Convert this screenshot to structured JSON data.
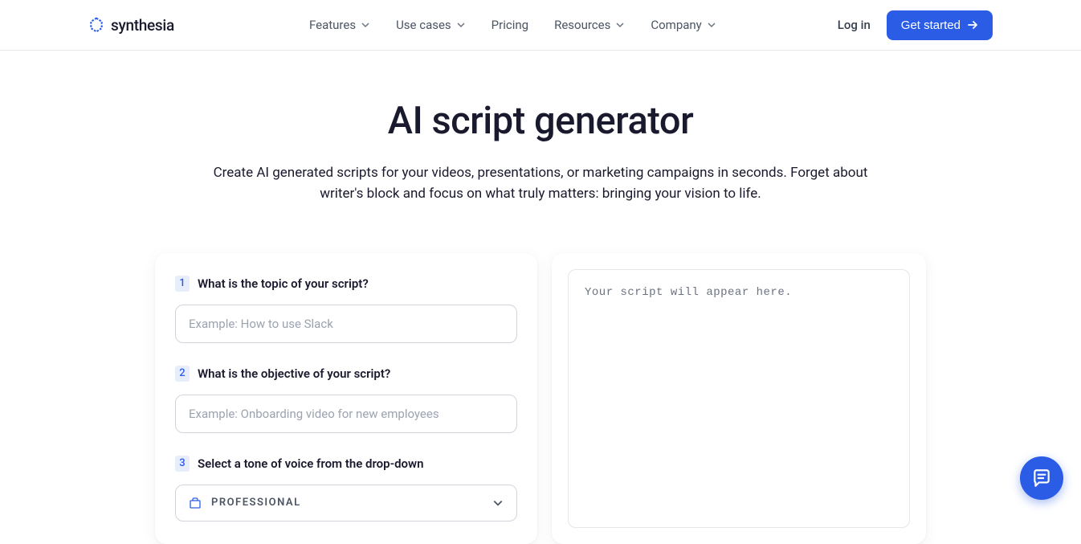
{
  "header": {
    "logo_text": "synthesia",
    "nav": {
      "features": "Features",
      "use_cases": "Use cases",
      "pricing": "Pricing",
      "resources": "Resources",
      "company": "Company"
    },
    "login": "Log in",
    "get_started": "Get started"
  },
  "hero": {
    "title": "AI script generator",
    "subtitle": "Create AI generated scripts for your videos, presentations, or marketing campaigns in seconds. Forget about writer's block and focus on what truly matters: bringing your vision to life."
  },
  "form": {
    "step1": {
      "number": "1",
      "label": "What is the topic of your script?",
      "placeholder": "Example: How to use Slack"
    },
    "step2": {
      "number": "2",
      "label": "What is the objective of your script?",
      "placeholder": "Example: Onboarding video for new employees"
    },
    "step3": {
      "number": "3",
      "label": "Select a tone of voice from the drop-down",
      "selected": "PROFESSIONAL"
    }
  },
  "output": {
    "placeholder": "Your script will appear here."
  }
}
